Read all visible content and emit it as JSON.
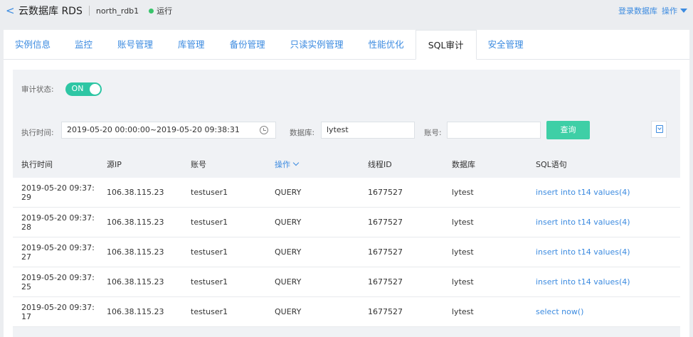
{
  "header": {
    "back": "<",
    "title": "云数据库 RDS",
    "instance": "north_rdb1",
    "status": "运行",
    "login_db": "登录数据库",
    "operations": "操作"
  },
  "tabs": [
    "实例信息",
    "监控",
    "账号管理",
    "库管理",
    "备份管理",
    "只读实例管理",
    "性能优化",
    "SQL审计",
    "安全管理"
  ],
  "active_tab": "SQL审计",
  "audit": {
    "label": "审计状态:",
    "toggle": "ON"
  },
  "filter": {
    "time_label": "执行时间:",
    "time_value": "2019-05-20 00:00:00~2019-05-20 09:38:31",
    "db_label": "数据库:",
    "db_value": "lytest",
    "account_label": "账号:",
    "account_value": "",
    "search_btn": "查询"
  },
  "table": {
    "headers": [
      "执行时间",
      "源IP",
      "账号",
      "操作",
      "线程ID",
      "数据库",
      "SQL语句"
    ],
    "rows": [
      [
        "2019-05-20 09:37:29",
        "106.38.115.23",
        "testuser1",
        "QUERY",
        "1677527",
        "lytest",
        "insert into t14 values(4)"
      ],
      [
        "2019-05-20 09:37:28",
        "106.38.115.23",
        "testuser1",
        "QUERY",
        "1677527",
        "lytest",
        "insert into t14 values(4)"
      ],
      [
        "2019-05-20 09:37:27",
        "106.38.115.23",
        "testuser1",
        "QUERY",
        "1677527",
        "lytest",
        "insert into t14 values(4)"
      ],
      [
        "2019-05-20 09:37:25",
        "106.38.115.23",
        "testuser1",
        "QUERY",
        "1677527",
        "lytest",
        "insert into t14 values(4)"
      ],
      [
        "2019-05-20 09:37:17",
        "106.38.115.23",
        "testuser1",
        "QUERY",
        "1677527",
        "lytest",
        "select now()"
      ]
    ]
  },
  "colors": {
    "accent": "#3c8be0",
    "toggle": "#2ec6a4",
    "button": "#3ecfa6",
    "status_dot": "#39c46b"
  }
}
